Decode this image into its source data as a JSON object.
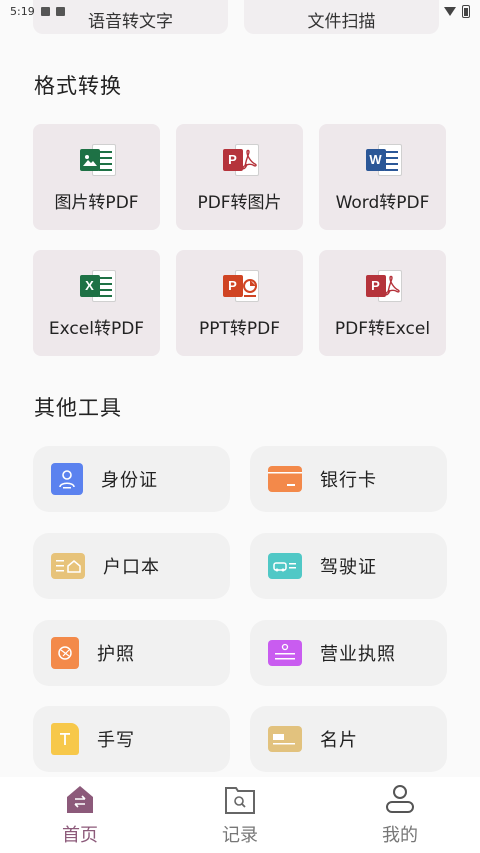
{
  "status_bar": {
    "time": "5:19"
  },
  "top_cards": {
    "left_label": "语音转文字",
    "right_label": "文件扫描"
  },
  "format_section": {
    "title": "格式转换",
    "tiles": [
      {
        "label": "图片转PDF",
        "icon": "excel-image-icon",
        "color": "#1e7145",
        "letter": ""
      },
      {
        "label": "PDF转图片",
        "icon": "pdf-icon",
        "color": "#b5333b",
        "letter": "P"
      },
      {
        "label": "Word转PDF",
        "icon": "word-icon",
        "color": "#2b5797",
        "letter": "W"
      },
      {
        "label": "Excel转PDF",
        "icon": "excel-icon",
        "color": "#1e7145",
        "letter": "X"
      },
      {
        "label": "PPT转PDF",
        "icon": "ppt-icon",
        "color": "#d04423",
        "letter": "P"
      },
      {
        "label": "PDF转Excel",
        "icon": "pdf-icon",
        "color": "#b5333b",
        "letter": "P"
      }
    ]
  },
  "tools_section": {
    "title": "其他工具",
    "items": [
      {
        "label": "身份证",
        "icon": "id-card-icon",
        "color": "#5b82ef"
      },
      {
        "label": "银行卡",
        "icon": "bank-card-icon",
        "color": "#f3894a"
      },
      {
        "label": "户口本",
        "icon": "household-register-icon",
        "color": "#e7c37a"
      },
      {
        "label": "驾驶证",
        "icon": "driver-license-icon",
        "color": "#50c8c6"
      },
      {
        "label": "护照",
        "icon": "passport-icon",
        "color": "#f38a4a"
      },
      {
        "label": "营业执照",
        "icon": "business-license-icon",
        "color": "#c95cf0"
      },
      {
        "label": "手写",
        "icon": "handwriting-icon",
        "color": "#f7c84a"
      },
      {
        "label": "名片",
        "icon": "business-card-icon",
        "color": "#e2c27e"
      }
    ]
  },
  "bottom_nav": {
    "items": [
      {
        "label": "首页",
        "icon": "home-icon",
        "active": true
      },
      {
        "label": "记录",
        "icon": "records-folder-icon",
        "active": false
      },
      {
        "label": "我的",
        "icon": "profile-icon",
        "active": false
      }
    ],
    "active_color": "#8c5a7a",
    "inactive_color": "#777777"
  }
}
